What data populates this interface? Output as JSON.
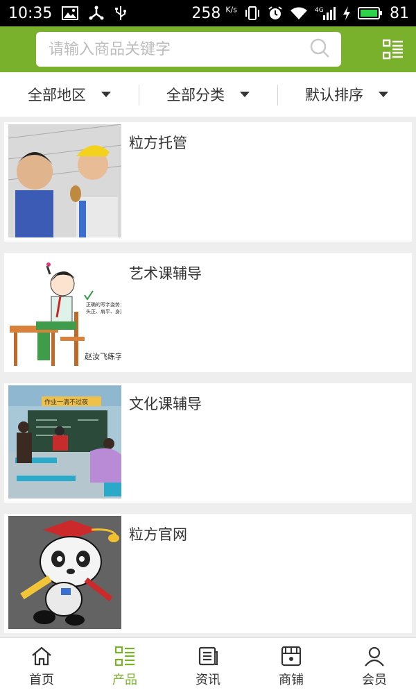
{
  "status_bar": {
    "time": "10:35",
    "net_speed": "258",
    "net_unit": "K/s",
    "net_type": "4G",
    "battery": "81",
    "icons": [
      "image-icon",
      "usb-share-icon",
      "usb-icon",
      "vibrate-icon",
      "alarm-icon",
      "wifi-icon",
      "signal-icon",
      "charging-icon",
      "battery-icon"
    ]
  },
  "search": {
    "placeholder": "请输入商品关键字",
    "icon": "search-icon"
  },
  "header": {
    "menu_icon": "grid-list-icon",
    "color": "#7ab12c"
  },
  "filters": [
    {
      "label": "全部地区"
    },
    {
      "label": "全部分类"
    },
    {
      "label": "默认排序"
    }
  ],
  "products": [
    {
      "title": "粒方托管"
    },
    {
      "title": "艺术课辅导",
      "thumb_caption": "赵汝飞练字",
      "thumb_note_line1": "正确的写字姿势：",
      "thumb_note_line2": "头正、肩平、身直、足安"
    },
    {
      "title": "文化课辅导",
      "thumb_banner": "作业一清不过夜"
    },
    {
      "title": "粒方官网"
    }
  ],
  "bottom_nav": [
    {
      "label": "首页",
      "icon": "home-icon",
      "active": false
    },
    {
      "label": "产品",
      "icon": "grid-list-icon",
      "active": true
    },
    {
      "label": "资讯",
      "icon": "news-icon",
      "active": false
    },
    {
      "label": "商铺",
      "icon": "shop-icon",
      "active": false
    },
    {
      "label": "会员",
      "icon": "user-icon",
      "active": false
    }
  ],
  "colors": {
    "accent": "#7ab12c",
    "text": "#333333",
    "background": "#eeeeee"
  }
}
